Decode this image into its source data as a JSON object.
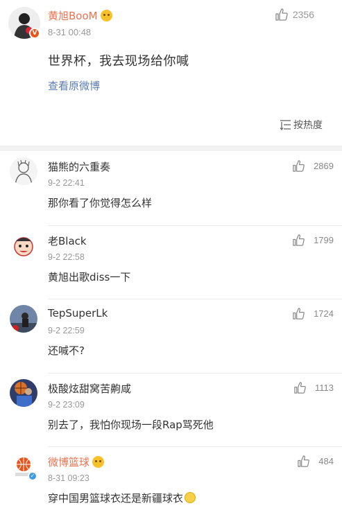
{
  "post": {
    "author": "黄旭BooM",
    "verified_mark": "V",
    "time": "8-31 00:48",
    "text": "世界杯，我去现场给你喊",
    "view_original": "查看原微博",
    "likes": "2356",
    "sort_label": "按热度"
  },
  "comments": [
    {
      "name": "猫熊的六重奏",
      "time": "9-2 22:41",
      "text": "那你看了你觉得怎么样",
      "likes": "2869",
      "avatar": "sketch-avatar"
    },
    {
      "name": "老Black",
      "time": "9-2 22:58",
      "text": "黄旭出歌diss一下",
      "likes": "1799",
      "avatar": "cartoon-avatar"
    },
    {
      "name": "TepSuperLk",
      "time": "9-2 22:59",
      "text": "还喊不?",
      "likes": "1724",
      "avatar": "photo-avatar"
    },
    {
      "name": "极酸炫甜窝苦齁咸",
      "time": "9-2 23:09",
      "text": "别去了，我怕你现场一段Rap骂死他",
      "likes": "1113",
      "avatar": "basketball-avatar"
    },
    {
      "name": "微博篮球",
      "time": "8-31 09:23",
      "text": "穿中国男篮球衣还是新疆球衣",
      "likes": "484",
      "avatar": "weibo-basketball-logo"
    }
  ],
  "colors": {
    "accent_orange": "#eb7350",
    "link_blue": "#5b7cb3",
    "muted": "#999999"
  }
}
